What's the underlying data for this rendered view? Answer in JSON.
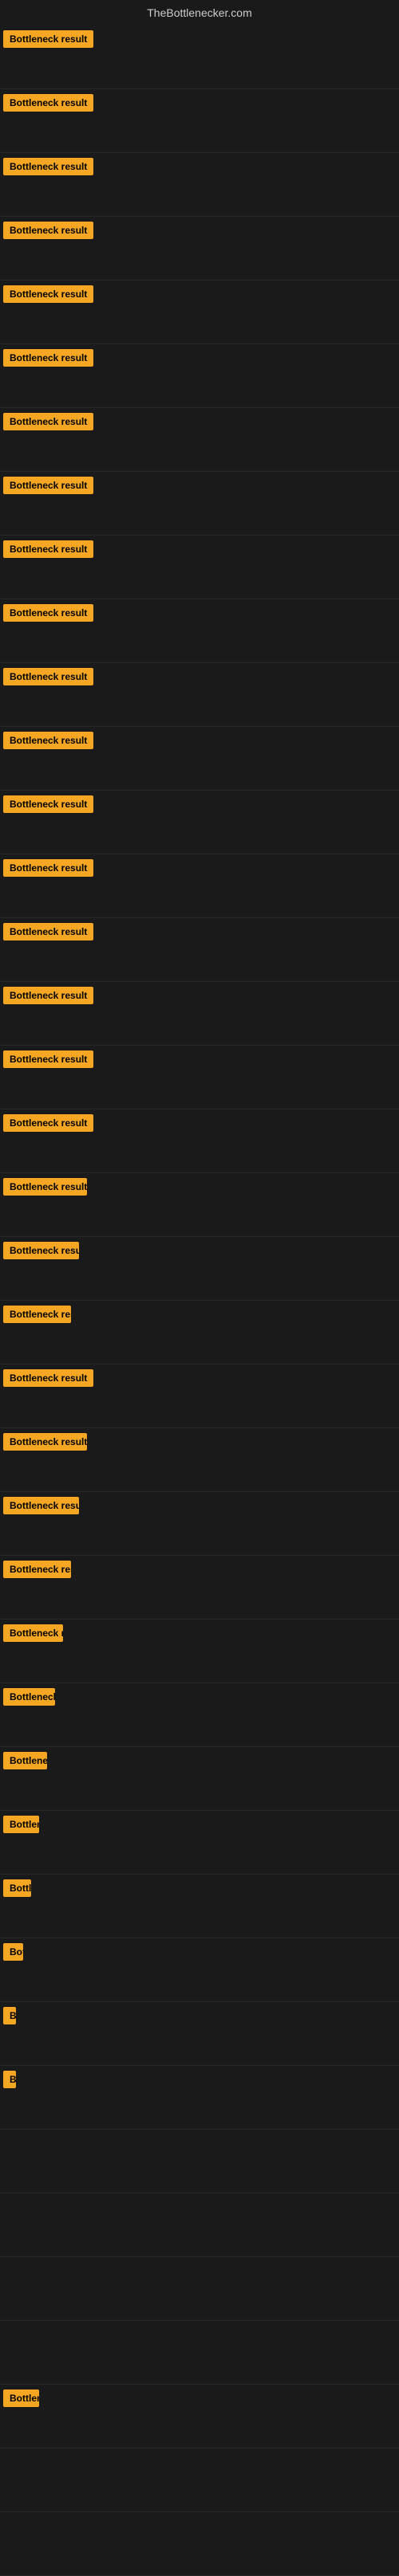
{
  "site": {
    "title": "TheBottlenecker.com"
  },
  "badge_label": "Bottleneck result",
  "rows": [
    {
      "id": 1,
      "width_class": "badge-full"
    },
    {
      "id": 2,
      "width_class": "badge-full"
    },
    {
      "id": 3,
      "width_class": "badge-full"
    },
    {
      "id": 4,
      "width_class": "badge-full"
    },
    {
      "id": 5,
      "width_class": "badge-full"
    },
    {
      "id": 6,
      "width_class": "badge-full"
    },
    {
      "id": 7,
      "width_class": "badge-full"
    },
    {
      "id": 8,
      "width_class": "badge-full"
    },
    {
      "id": 9,
      "width_class": "badge-full"
    },
    {
      "id": 10,
      "width_class": "badge-full"
    },
    {
      "id": 11,
      "width_class": "badge-full"
    },
    {
      "id": 12,
      "width_class": "badge-full"
    },
    {
      "id": 13,
      "width_class": "badge-full"
    },
    {
      "id": 14,
      "width_class": "badge-full"
    },
    {
      "id": 15,
      "width_class": "badge-full"
    },
    {
      "id": 16,
      "width_class": "badge-w1"
    },
    {
      "id": 17,
      "width_class": "badge-full"
    },
    {
      "id": 18,
      "width_class": "badge-w2"
    },
    {
      "id": 19,
      "width_class": "badge-w3"
    },
    {
      "id": 20,
      "width_class": "badge-w4"
    },
    {
      "id": 21,
      "width_class": "badge-w5"
    },
    {
      "id": 22,
      "width_class": "badge-w1"
    },
    {
      "id": 23,
      "width_class": "badge-w3"
    },
    {
      "id": 24,
      "width_class": "badge-w4"
    },
    {
      "id": 25,
      "width_class": "badge-w5"
    },
    {
      "id": 26,
      "width_class": "badge-w6"
    },
    {
      "id": 27,
      "width_class": "badge-w7"
    },
    {
      "id": 28,
      "width_class": "badge-w8"
    },
    {
      "id": 29,
      "width_class": "badge-w9"
    },
    {
      "id": 30,
      "width_class": "badge-w10"
    },
    {
      "id": 31,
      "width_class": "badge-w11"
    },
    {
      "id": 32,
      "width_class": "badge-w12"
    },
    {
      "id": 33,
      "width_class": "badge-w13"
    },
    {
      "id": 34,
      "width_class": "badge-full"
    },
    {
      "id": 35,
      "width_class": "badge-full"
    },
    {
      "id": 36,
      "width_class": "badge-full"
    },
    {
      "id": 37,
      "width_class": "badge-full"
    },
    {
      "id": 38,
      "width_class": "badge-full"
    },
    {
      "id": 39,
      "width_class": "badge-full"
    },
    {
      "id": 40,
      "width_class": "badge-full"
    }
  ]
}
